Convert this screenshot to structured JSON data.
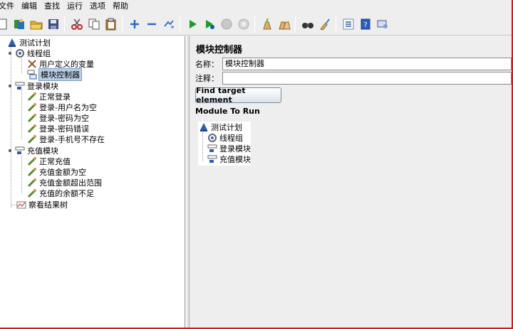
{
  "menu": [
    "文件",
    "编辑",
    "查找",
    "运行",
    "选项",
    "帮助"
  ],
  "toolbar": {
    "buttons": [
      "new-icon",
      "templates-icon",
      "open-icon",
      "save-icon",
      "cut-icon",
      "copy-icon",
      "paste-icon",
      "expand-icon",
      "collapse-icon",
      "toggle-icon",
      "start-icon",
      "start-no-pause-icon",
      "stop-icon",
      "shutdown-icon",
      "clear-icon",
      "clear-all-icon",
      "search-icon",
      "reset-search-icon",
      "function-helper-icon",
      "help-icon",
      "remote-icon"
    ]
  },
  "tree": {
    "items": [
      {
        "label": "测试计划",
        "icon": "test-plan-icon"
      },
      {
        "label": "线程组",
        "icon": "thread-group-icon"
      },
      {
        "label": "用户定义的变量",
        "icon": "variables-icon"
      },
      {
        "label": "模块控制器",
        "icon": "module-controller-icon"
      },
      {
        "label": "登录模块",
        "icon": "simple-controller-icon"
      },
      {
        "label": "正常登录",
        "icon": "sampler-icon"
      },
      {
        "label": "登录-用户名为空",
        "icon": "sampler-icon"
      },
      {
        "label": "登录-密码为空",
        "icon": "sampler-icon"
      },
      {
        "label": "登录-密码错误",
        "icon": "sampler-icon"
      },
      {
        "label": "登录-手机号不存在",
        "icon": "sampler-icon"
      },
      {
        "label": "充值模块",
        "icon": "simple-controller-icon"
      },
      {
        "label": "正常充值",
        "icon": "sampler-icon"
      },
      {
        "label": "充值金额为空",
        "icon": "sampler-icon"
      },
      {
        "label": "充值金额超出范围",
        "icon": "sampler-icon"
      },
      {
        "label": "充值的余额不足",
        "icon": "sampler-icon"
      },
      {
        "label": "察看结果树",
        "icon": "listener-icon"
      }
    ]
  },
  "panel": {
    "title": "模块控制器",
    "name_label": "名称：",
    "name_value": "模块控制器",
    "comment_label": "注释：",
    "comment_value": "",
    "find_button": "Find target element",
    "module_label": "Module To Run",
    "module_tree": [
      "测试计划",
      "线程组",
      "登录模块",
      "充值模块"
    ]
  },
  "colors": {
    "selection": "#b8cfe5",
    "frame": "#c81e1e",
    "window_bg": "#eeeeee"
  }
}
